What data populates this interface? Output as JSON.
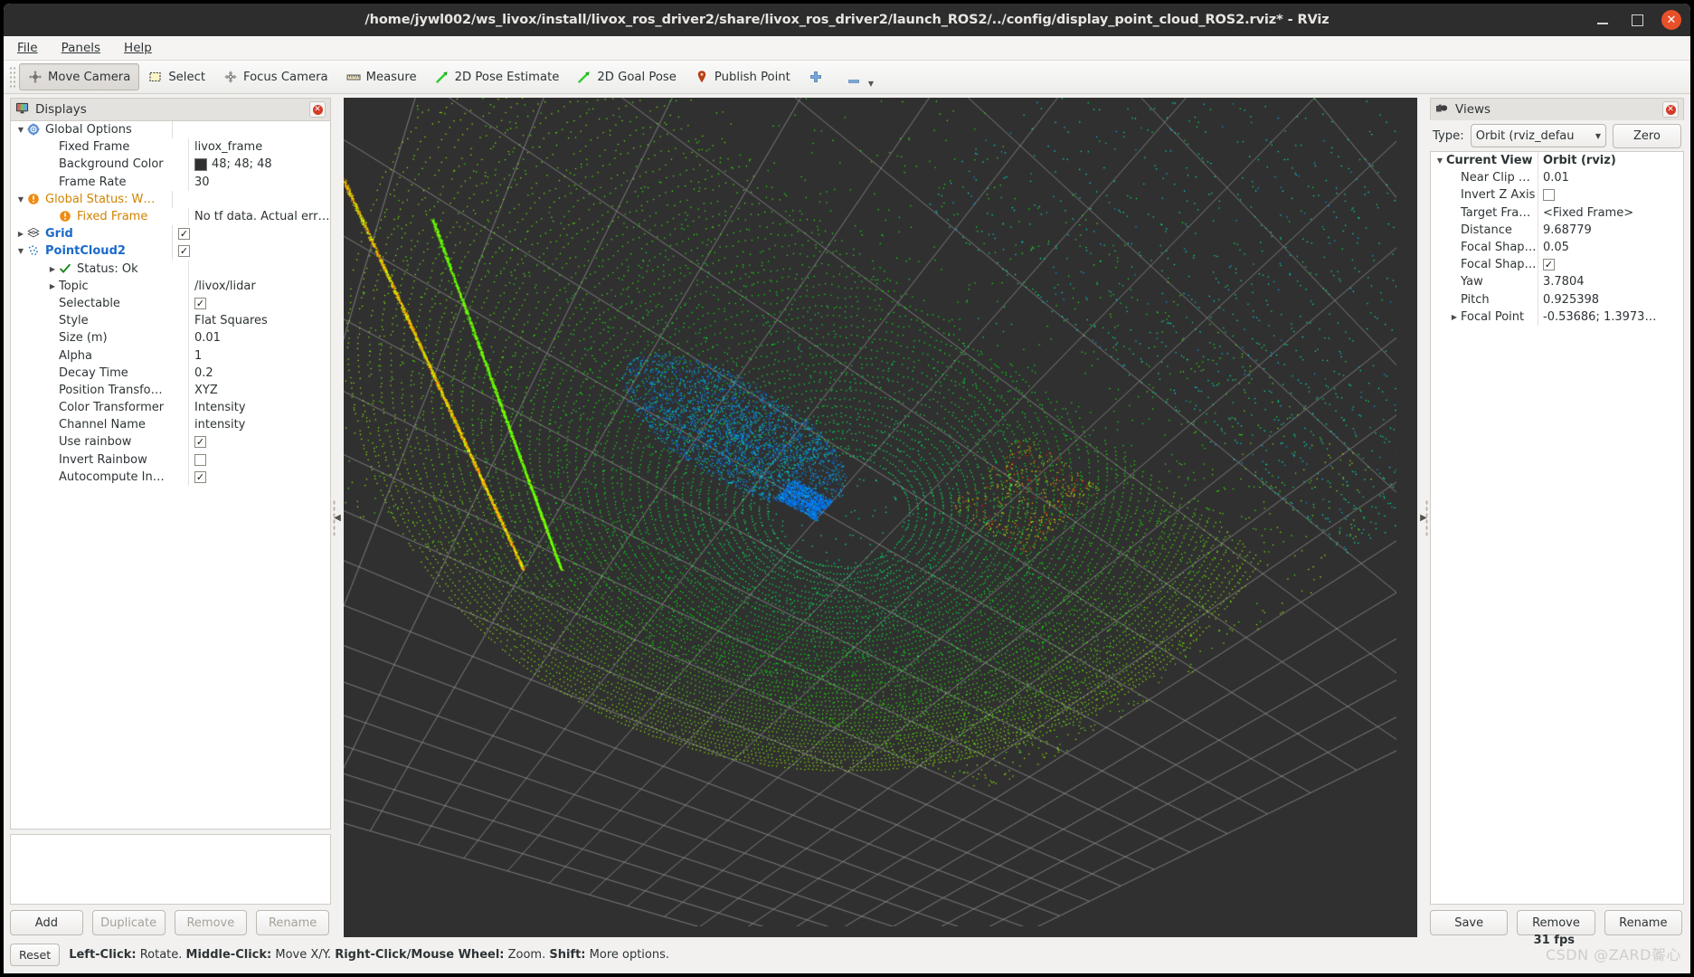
{
  "window": {
    "title": "/home/jywl002/ws_livox/install/livox_ros_driver2/share/livox_ros_driver2/launch_ROS2/../config/display_point_cloud_ROS2.rviz* - RViz",
    "minimize_label": "–",
    "maximize_label": "□",
    "close_label": "✕"
  },
  "menu": [
    {
      "label": "File"
    },
    {
      "label": "Panels"
    },
    {
      "label": "Help"
    }
  ],
  "toolbar": [
    {
      "label": "Move Camera",
      "icon": "move-camera-icon",
      "active": true
    },
    {
      "label": "Select",
      "icon": "select-icon",
      "active": false
    },
    {
      "label": "Focus Camera",
      "icon": "focus-camera-icon",
      "active": false
    },
    {
      "label": "Measure",
      "icon": "measure-icon",
      "active": false
    },
    {
      "label": "2D Pose Estimate",
      "icon": "pose-arrow-icon",
      "active": false
    },
    {
      "label": "2D Goal Pose",
      "icon": "pose-arrow-icon",
      "active": false
    },
    {
      "label": "Publish Point",
      "icon": "map-pin-icon",
      "active": false
    },
    {
      "label": "",
      "icon": "plus-icon",
      "active": false
    },
    {
      "label": "",
      "icon": "minus-icon",
      "active": false
    }
  ],
  "displays": {
    "title": "Displays",
    "icon": "displays-monitor-icon",
    "close_icon": "close-icon",
    "rows": [
      {
        "indent": 1,
        "twisty": "down",
        "icon": "gear-icon",
        "name": "Global Options",
        "style": "plain",
        "value": "",
        "value_type": "text"
      },
      {
        "indent": 2,
        "twisty": "",
        "icon": "",
        "name": "Fixed Frame",
        "style": "plain",
        "value": "livox_frame",
        "value_type": "text"
      },
      {
        "indent": 2,
        "twisty": "",
        "icon": "",
        "name": "Background Color",
        "style": "plain",
        "value": "48; 48; 48",
        "value_type": "color",
        "color": "#303030"
      },
      {
        "indent": 2,
        "twisty": "",
        "icon": "",
        "name": "Frame Rate",
        "style": "plain",
        "value": "30",
        "value_type": "text"
      },
      {
        "indent": 1,
        "twisty": "down",
        "icon": "warning-icon",
        "name": "Global Status: W…",
        "style": "warn",
        "value": "",
        "value_type": "text"
      },
      {
        "indent": 2,
        "twisty": "",
        "icon": "warning-icon",
        "name": "Fixed Frame",
        "style": "warn",
        "value": "No tf data.  Actual err…",
        "value_type": "text"
      },
      {
        "indent": 1,
        "twisty": "right",
        "icon": "grid-icon",
        "name": "Grid",
        "style": "blue",
        "value": "checked",
        "value_type": "checkbox"
      },
      {
        "indent": 1,
        "twisty": "down",
        "icon": "pointcloud-icon",
        "name": "PointCloud2",
        "style": "blue",
        "value": "checked",
        "value_type": "checkbox"
      },
      {
        "indent": 2,
        "twisty": "right",
        "icon": "ok-check-icon",
        "name": "Status: Ok",
        "style": "plain",
        "value": "",
        "value_type": "text"
      },
      {
        "indent": 2,
        "twisty": "right",
        "icon": "",
        "name": "Topic",
        "style": "plain",
        "value": "/livox/lidar",
        "value_type": "text"
      },
      {
        "indent": 2,
        "twisty": "",
        "icon": "",
        "name": "Selectable",
        "style": "plain",
        "value": "checked",
        "value_type": "checkbox"
      },
      {
        "indent": 2,
        "twisty": "",
        "icon": "",
        "name": "Style",
        "style": "plain",
        "value": "Flat Squares",
        "value_type": "text"
      },
      {
        "indent": 2,
        "twisty": "",
        "icon": "",
        "name": "Size (m)",
        "style": "plain",
        "value": "0.01",
        "value_type": "text"
      },
      {
        "indent": 2,
        "twisty": "",
        "icon": "",
        "name": "Alpha",
        "style": "plain",
        "value": "1",
        "value_type": "text"
      },
      {
        "indent": 2,
        "twisty": "",
        "icon": "",
        "name": "Decay Time",
        "style": "plain",
        "value": "0.2",
        "value_type": "text"
      },
      {
        "indent": 2,
        "twisty": "",
        "icon": "",
        "name": "Position Transfo…",
        "style": "plain",
        "value": "XYZ",
        "value_type": "text"
      },
      {
        "indent": 2,
        "twisty": "",
        "icon": "",
        "name": "Color Transformer",
        "style": "plain",
        "value": "Intensity",
        "value_type": "text"
      },
      {
        "indent": 2,
        "twisty": "",
        "icon": "",
        "name": "Channel Name",
        "style": "plain",
        "value": "intensity",
        "value_type": "text"
      },
      {
        "indent": 2,
        "twisty": "",
        "icon": "",
        "name": "Use rainbow",
        "style": "plain",
        "value": "checked",
        "value_type": "checkbox"
      },
      {
        "indent": 2,
        "twisty": "",
        "icon": "",
        "name": "Invert Rainbow",
        "style": "plain",
        "value": "unchecked",
        "value_type": "checkbox"
      },
      {
        "indent": 2,
        "twisty": "",
        "icon": "",
        "name": "Autocompute In…",
        "style": "plain",
        "value": "checked",
        "value_type": "checkbox"
      }
    ],
    "buttons": [
      {
        "label": "Add",
        "enabled": true
      },
      {
        "label": "Duplicate",
        "enabled": false
      },
      {
        "label": "Remove",
        "enabled": false
      },
      {
        "label": "Rename",
        "enabled": false
      }
    ]
  },
  "views": {
    "title": "Views",
    "icon": "views-camera-icon",
    "close_icon": "close-icon",
    "type_label": "Type:",
    "type_value": "Orbit (rviz_defau",
    "zero_label": "Zero",
    "rows": [
      {
        "indent": 1,
        "twisty": "down",
        "name": "Current View",
        "value": "Orbit (rviz)",
        "bold": true,
        "value_type": "text"
      },
      {
        "indent": 2,
        "twisty": "",
        "name": "Near Clip …",
        "value": "0.01",
        "bold": false,
        "value_type": "text"
      },
      {
        "indent": 2,
        "twisty": "",
        "name": "Invert Z Axis",
        "value": "unchecked",
        "bold": false,
        "value_type": "checkbox"
      },
      {
        "indent": 2,
        "twisty": "",
        "name": "Target Fra…",
        "value": "<Fixed Frame>",
        "bold": false,
        "value_type": "text"
      },
      {
        "indent": 2,
        "twisty": "",
        "name": "Distance",
        "value": "9.68779",
        "bold": false,
        "value_type": "text"
      },
      {
        "indent": 2,
        "twisty": "",
        "name": "Focal Shap…",
        "value": "0.05",
        "bold": false,
        "value_type": "text"
      },
      {
        "indent": 2,
        "twisty": "",
        "name": "Focal Shap…",
        "value": "checked",
        "bold": false,
        "value_type": "checkbox"
      },
      {
        "indent": 2,
        "twisty": "",
        "name": "Yaw",
        "value": "3.7804",
        "bold": false,
        "value_type": "text"
      },
      {
        "indent": 2,
        "twisty": "",
        "name": "Pitch",
        "value": "0.925398",
        "bold": false,
        "value_type": "text"
      },
      {
        "indent": 2,
        "twisty": "right",
        "name": "Focal Point",
        "value": "-0.53686; 1.3973…",
        "bold": false,
        "value_type": "text"
      }
    ],
    "buttons": [
      {
        "label": "Save",
        "enabled": true
      },
      {
        "label": "Remove",
        "enabled": true
      },
      {
        "label": "Rename",
        "enabled": true
      }
    ]
  },
  "statusbar": {
    "reset_label": "Reset",
    "hints": [
      {
        "bold": "Left-Click:",
        "text": " Rotate. "
      },
      {
        "bold": "Middle-Click:",
        "text": " Move X/Y. "
      },
      {
        "bold": "Right-Click/Mouse Wheel:",
        "text": " Zoom. "
      },
      {
        "bold": "Shift:",
        "text": " More options."
      }
    ],
    "fps": "31 fps",
    "watermark": "CSDN @ZARD嗧心"
  },
  "viewport": {
    "background_color": "#303030",
    "grid_color": "#9a9a9a",
    "collapse_left_arrow": "◀",
    "collapse_right_arrow": "▶"
  }
}
